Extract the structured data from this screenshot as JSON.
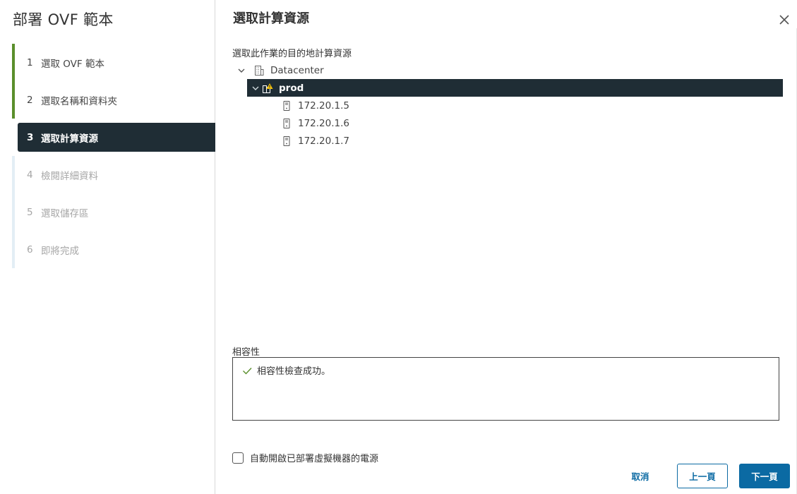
{
  "wizard": {
    "title": "部署 OVF 範本",
    "steps": [
      {
        "num": "1",
        "label": "選取 OVF 範本",
        "state": "done"
      },
      {
        "num": "2",
        "label": "選取名稱和資料夾",
        "state": "done"
      },
      {
        "num": "3",
        "label": "選取計算資源",
        "state": "active"
      },
      {
        "num": "4",
        "label": "檢閱詳細資料",
        "state": "pending"
      },
      {
        "num": "5",
        "label": "選取儲存區",
        "state": "pending"
      },
      {
        "num": "6",
        "label": "即將完成",
        "state": "pending"
      }
    ]
  },
  "main": {
    "title": "選取計算資源",
    "subtitle": "選取此作業的目的地計算資源",
    "tree": {
      "datacenter": {
        "label": "Datacenter",
        "icon": "datacenter-icon"
      },
      "cluster": {
        "label": "prod",
        "icon": "cluster-warning-icon"
      },
      "hosts": [
        {
          "label": "172.20.1.5",
          "icon": "host-icon"
        },
        {
          "label": "172.20.1.6",
          "icon": "host-icon"
        },
        {
          "label": "172.20.1.7",
          "icon": "host-icon"
        }
      ]
    },
    "compatibility": {
      "label": "相容性",
      "message": "相容性檢查成功。"
    },
    "power_on_label": "自動開啟已部署虛擬機器的電源"
  },
  "footer": {
    "cancel": "取消",
    "back": "上一頁",
    "next": "下一頁"
  },
  "colors": {
    "selected_bg": "#1f2d35",
    "done_step": "#5a8f2b",
    "primary": "#0b6aa3",
    "success": "#5a8f2b"
  }
}
